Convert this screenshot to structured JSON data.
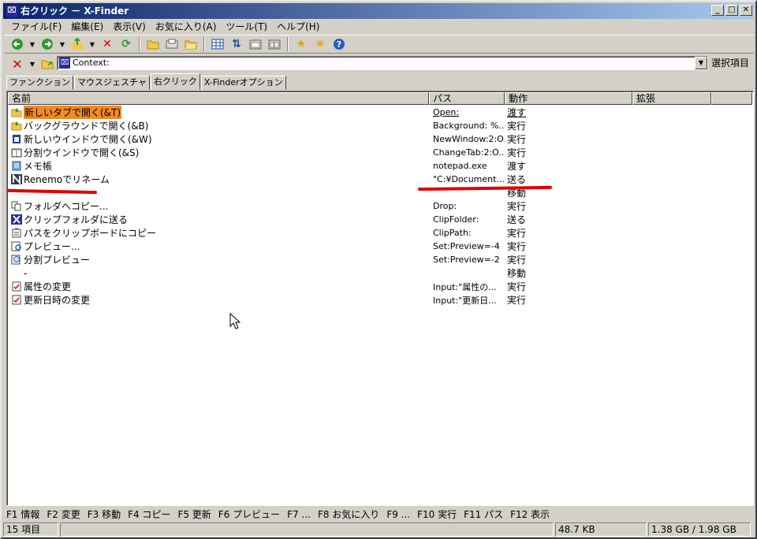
{
  "window": {
    "title": "右クリック － X-Finder",
    "app_icon": "xfinder-icon"
  },
  "menu": [
    "ファイル(F)",
    "編集(E)",
    "表示(V)",
    "お気に入り(A)",
    "ツール(T)",
    "ヘルプ(H)"
  ],
  "address": {
    "value": "Context:",
    "select_label": "選択項目"
  },
  "tabs": [
    "ファンクション",
    "マウスジェスチャ",
    "右クリック",
    "X-Finderオプション"
  ],
  "columns": [
    "名前",
    "パス",
    "動作",
    "拡張"
  ],
  "rows": [
    {
      "name": "新しいタブで開く(&T)",
      "path": "Open:",
      "action": "渡す",
      "icon": "folder-open-icon"
    },
    {
      "name": "バックグラウンドで開く(&B)",
      "path": "Background: %...",
      "action": "実行",
      "icon": "folder-open-icon"
    },
    {
      "name": "新しいウインドウで開く(&W)",
      "path": "NewWindow:2:O...",
      "action": "実行",
      "icon": "new-window-icon"
    },
    {
      "name": "分割ウインドウで開く(&S)",
      "path": "ChangeTab:2:O...",
      "action": "実行",
      "icon": "split-window-icon"
    },
    {
      "name": "メモ帳",
      "path": "notepad.exe",
      "action": "渡す",
      "icon": "notepad-icon"
    },
    {
      "name": "Renemoでリネーム",
      "path": "\"C:¥Document...",
      "action": "送る",
      "icon": "renemo-icon"
    },
    {
      "name": "",
      "path": "",
      "action": "移動",
      "icon": ""
    },
    {
      "name": "フォルダへコピー...",
      "path": "Drop:",
      "action": "実行",
      "icon": "copy-icon"
    },
    {
      "name": "クリップフォルダに送る",
      "path": "ClipFolder:",
      "action": "送る",
      "icon": "xfinder-icon"
    },
    {
      "name": "パスをクリップボードにコピー",
      "path": "ClipPath:",
      "action": "実行",
      "icon": "clipboard-icon"
    },
    {
      "name": "プレビュー...",
      "path": "Set:Preview=-4",
      "action": "実行",
      "icon": "preview-icon"
    },
    {
      "name": "分割プレビュー",
      "path": "Set:Preview=-2",
      "action": "実行",
      "icon": "split-preview-icon"
    },
    {
      "name": "-",
      "path": "",
      "action": "移動",
      "icon": ""
    },
    {
      "name": "属性の変更",
      "path": "Input:\"属性の...",
      "action": "実行",
      "icon": "checkbox-icon"
    },
    {
      "name": "更新日時の変更",
      "path": "Input:\"更新日...",
      "action": "実行",
      "icon": "checkbox-icon"
    }
  ],
  "fkeys": [
    "F1 情報",
    "F2 変更",
    "F3 移動",
    "F4 コピー",
    "F5 更新",
    "F6 プレビュー",
    "F7 ...",
    "F8 お気に入り",
    "F9 ...",
    "F10 実行",
    "F11 パス",
    "F12 表示"
  ],
  "status": {
    "count": "15 項目",
    "size": "48.7 KB",
    "disk": "1.38 GB / 1.98 GB"
  },
  "colors": {
    "selection": "#f08a24",
    "title_start": "#0a246a",
    "annotation_red": "#e00000"
  }
}
